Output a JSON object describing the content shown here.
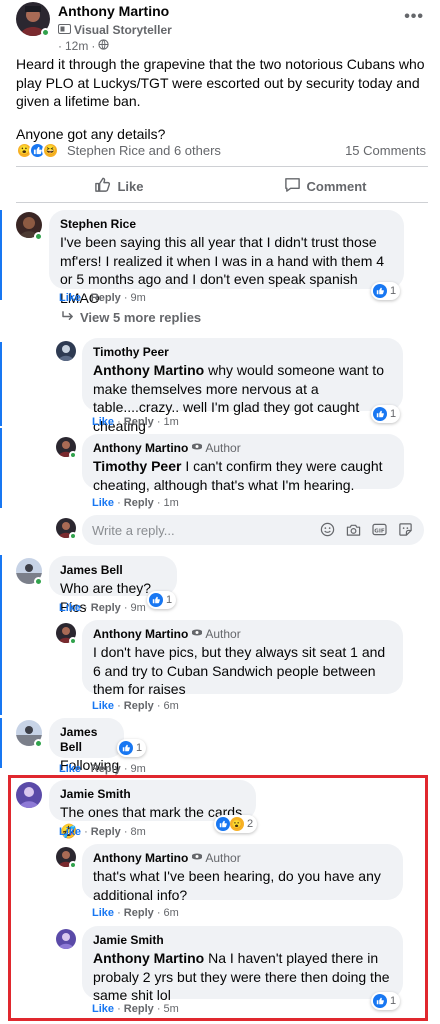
{
  "post": {
    "author": "Anthony Martino",
    "badge": "Visual Storyteller",
    "time": "12m",
    "more_label": "•••",
    "body": [
      "Heard it through the grapevine that the two notorious Cubans who play PLO at Luckys/TGT were escorted out by security today and given a lifetime ban.",
      "Anyone got any details?"
    ],
    "reactions_text": "Stephen Rice and 6 others",
    "comments_count": "15 Comments",
    "like_label": "Like",
    "comment_label": "Comment"
  },
  "comments": [
    {
      "name": "Stephen Rice",
      "text": "I've been saying this all year that I didn't trust those mf'ers! I realized it when I was in a hand with them 4 or 5 months ago and I don't even speak spanish LMAO",
      "like": "Like",
      "reply": "Reply",
      "time": "9m",
      "reactions": "1"
    },
    {
      "view_more": "View 5 more replies"
    },
    {
      "name": "Timothy Peer",
      "mention": "Anthony Martino",
      "text": " why would someone want to make themselves more nervous at a table....crazy.. well I'm glad they got caught cheating",
      "like": "Like",
      "reply": "Reply",
      "time": "1m",
      "reactions": "1"
    },
    {
      "name": "Anthony Martino",
      "author_tag": "Author",
      "mention": "Timothy Peer",
      "text": " I can't confirm they were caught cheating, although that's what I'm hearing.",
      "like": "Like",
      "reply": "Reply",
      "time": "1m"
    },
    {
      "reply_placeholder": "Write a reply..."
    },
    {
      "name": "James Bell",
      "text": "Who are they? Pics",
      "like": "Like",
      "reply": "Reply",
      "time": "9m",
      "reactions": "1"
    },
    {
      "name": "Anthony Martino",
      "author_tag": "Author",
      "text": "I don't have pics, but they always sit seat 1 and 6 and try to Cuban Sandwich people between them for raises",
      "like": "Like",
      "reply": "Reply",
      "time": "6m"
    },
    {
      "name": "James Bell",
      "text": "Following",
      "like": "Like",
      "reply": "Reply",
      "time": "9m",
      "reactions": "1"
    },
    {
      "name": "Jamie Smith",
      "text": "The ones that mark the cards 🤣",
      "like": "Like",
      "reply": "Reply",
      "time": "8m",
      "reactions": "2"
    },
    {
      "name": "Anthony Martino",
      "author_tag": "Author",
      "text": "that's what I've been hearing, do you have any additional info?",
      "like": "Like",
      "reply": "Reply",
      "time": "6m"
    },
    {
      "name": "Jamie Smith",
      "mention": "Anthony Martino",
      "text": " Na I haven't played there in probaly 2 yrs but they were there then doing the same shit lol",
      "like": "Like",
      "reply": "Reply",
      "time": "5m",
      "reactions": "1"
    }
  ],
  "colors": {
    "link_blue": "#1877f2",
    "bubble_gray": "#f0f2f5",
    "highlight_red": "#e0282e",
    "online_green": "#31a24c"
  },
  "icons": [
    "globe-icon",
    "storyteller-badge-icon",
    "thumbs-up-icon",
    "comment-icon",
    "reply-arrow-icon",
    "emoji-icon",
    "camera-icon",
    "gif-icon",
    "sticker-icon",
    "author-badge-icon"
  ]
}
